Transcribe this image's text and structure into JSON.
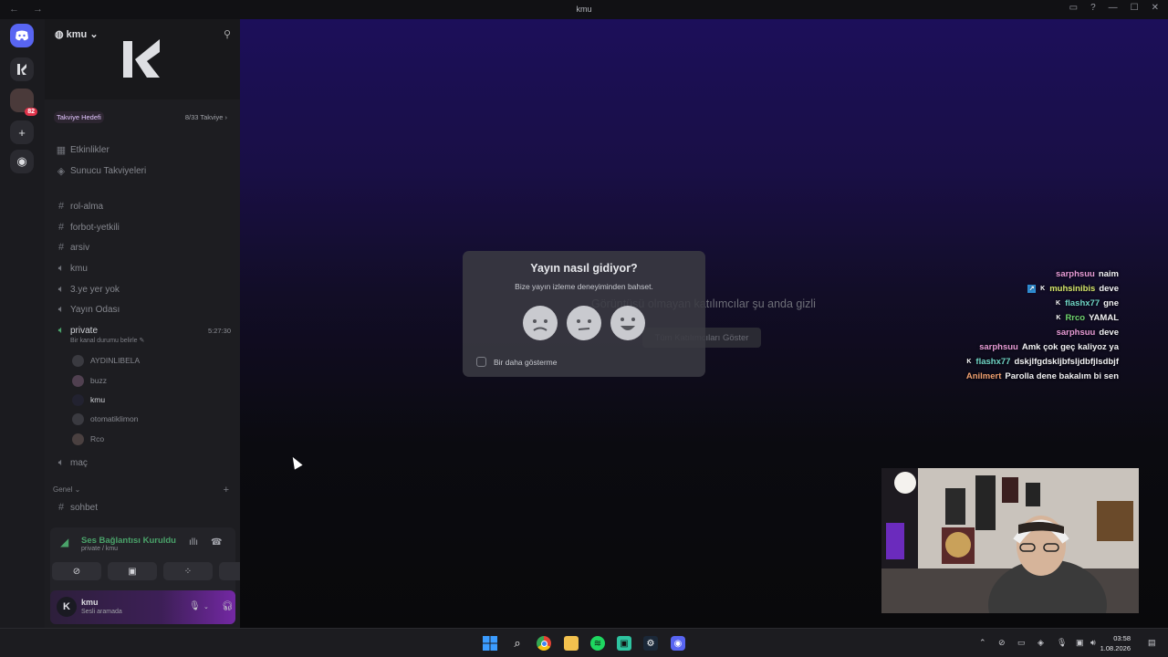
{
  "window": {
    "title": "kmu",
    "nav_glyphs": "← →",
    "controls": [
      "▭",
      "?",
      "—",
      "☐",
      "✕"
    ]
  },
  "server": {
    "name": "kmu",
    "boost_label": "Takviye Hedefi",
    "boost_count": "8/33 Takviye",
    "badge_count": "82"
  },
  "channels": {
    "top": [
      {
        "label": "Etkinlikler",
        "icon": "calendar-icon"
      },
      {
        "label": "Sunucu Takviyeleri",
        "icon": "boost-icon"
      }
    ],
    "list": [
      {
        "label": "rol-alma",
        "type": "text"
      },
      {
        "label": "forbot-yetkili",
        "type": "text"
      },
      {
        "label": "arsiv",
        "type": "text"
      },
      {
        "label": "kmu",
        "type": "voice"
      },
      {
        "label": "3.ye yer yok",
        "type": "voice"
      },
      {
        "label": "Yayın Odası",
        "type": "voice"
      }
    ],
    "active_voice": {
      "label": "private",
      "time": "5:27:30",
      "status_hint": "Bir kanal durumu belirle",
      "users": [
        "AYDINLIBELA",
        "buzz",
        "kmu",
        "otomatiklimon",
        "Rco"
      ]
    },
    "after": {
      "label": "maç",
      "type": "voice"
    },
    "category": "Genel",
    "category_first": {
      "label": "sohbet",
      "type": "text"
    }
  },
  "voice_panel": {
    "status": "Ses Bağlantısı Kuruldu",
    "channel": "private / kmu"
  },
  "user_panel": {
    "name": "kmu",
    "status": "Sesli aramada"
  },
  "stage": {
    "hidden_msg": "Görüntüsü olmayan katılımcılar şu anda gizli",
    "show_all": "Tüm Katılımcıları Göster"
  },
  "modal": {
    "title": "Yayın nasıl gidiyor?",
    "subtitle": "Bize yayın izleme deneyiminden bahset.",
    "checkbox_label": "Bir daha gösterme"
  },
  "chat": [
    {
      "user": "sarphsuu",
      "color": "#e79bd6",
      "msg": "naim",
      "badges": []
    },
    {
      "user": "muhsinibis",
      "color": "#d6e66a",
      "msg": "deve",
      "badges": [
        "↗",
        "K"
      ]
    },
    {
      "user": "flashx77",
      "color": "#6fd4c5",
      "msg": "gne",
      "badges": [
        "K"
      ]
    },
    {
      "user": "Rrco",
      "color": "#6fd46f",
      "msg": "YAMAL",
      "badges": [
        "K"
      ]
    },
    {
      "user": "sarphsuu",
      "color": "#e79bd6",
      "msg": "deve",
      "badges": []
    },
    {
      "user": "sarphsuu",
      "color": "#e79bd6",
      "msg": "Amk çok geç kaliyoz ya",
      "badges": []
    },
    {
      "user": "flashx77",
      "color": "#6fd4c5",
      "msg": "dskjlfgdskljbfsljdbfjlsdbjf",
      "badges": [
        "K"
      ]
    },
    {
      "user": "Anilmert",
      "color": "#f0a070",
      "msg": "Parolla dene bakalım bi sen",
      "badges": []
    }
  ],
  "taskbar": {
    "time": "03:58",
    "date": "1.08.2026"
  }
}
